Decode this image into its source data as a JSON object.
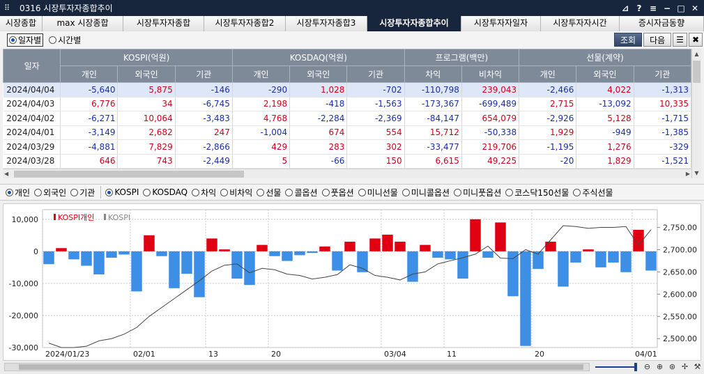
{
  "window": {
    "title": "0316 시장투자자종합추이",
    "icon": "grid-icon",
    "controls": [
      "pin-icon",
      "help-icon",
      "restore-icon",
      "minimize-icon",
      "maximize-icon",
      "close-icon"
    ],
    "control_glyphs": [
      "⊿",
      "?",
      "≡",
      "−",
      "□",
      "✕"
    ]
  },
  "tabs": [
    {
      "label": "시장종합",
      "w": 61
    },
    {
      "label": "max 시장종합",
      "w": 116
    },
    {
      "label": "시장투자자종합",
      "w": 116
    },
    {
      "label": "시장투자자종합2",
      "w": 117
    },
    {
      "label": "시장투자자종합3",
      "w": 117
    },
    {
      "label": "시장투자자종합추이",
      "w": 135,
      "active": true
    },
    {
      "label": "시장투자자일자",
      "w": 114
    },
    {
      "label": "시장투자자시간",
      "w": 113
    },
    {
      "label": "증시자금동향",
      "w": 121
    }
  ],
  "toolbar": {
    "radio_daily": "일자별",
    "radio_hourly": "시간별",
    "btn_query": "조회",
    "btn_next": "다음",
    "btn_list": "☰",
    "btn_tool": "✖"
  },
  "table": {
    "corner": "일자",
    "groups": [
      "KOSPI(억원)",
      "KOSDAQ(억원)",
      "프로그램(백만)",
      "선물(계약)"
    ],
    "subheaders": [
      "개인",
      "외국인",
      "기관",
      "개인",
      "외국인",
      "기관",
      "차익",
      "비차익",
      "개인",
      "외국인",
      "기관"
    ],
    "rows": [
      {
        "date": "2024/04/04",
        "vals": [
          "-5,640",
          "5,875",
          "-146",
          "-290",
          "1,028",
          "-702",
          "-110,798",
          "239,043",
          "-2,466",
          "4,022",
          "-1,313"
        ]
      },
      {
        "date": "2024/04/03",
        "vals": [
          "6,776",
          "34",
          "-6,745",
          "2,198",
          "-418",
          "-1,563",
          "-173,367",
          "-699,489",
          "2,715",
          "-13,092",
          "10,335"
        ]
      },
      {
        "date": "2024/04/02",
        "vals": [
          "-6,271",
          "10,064",
          "-3,483",
          "4,768",
          "-2,284",
          "-2,369",
          "-84,147",
          "654,079",
          "-2,926",
          "5,128",
          "-1,715"
        ]
      },
      {
        "date": "2024/04/01",
        "vals": [
          "-3,149",
          "2,682",
          "247",
          "-1,004",
          "674",
          "554",
          "15,712",
          "-50,338",
          "1,929",
          "-949",
          "-1,385"
        ]
      },
      {
        "date": "2024/03/29",
        "vals": [
          "-4,881",
          "7,829",
          "-2,866",
          "429",
          "283",
          "302",
          "-33,477",
          "219,706",
          "-1,195",
          "1,276",
          "-329"
        ]
      },
      {
        "date": "2024/03/28",
        "vals": [
          "646",
          "743",
          "-2,449",
          "5",
          "-66",
          "150",
          "6,615",
          "49,225",
          "-20",
          "1,829",
          "-1,521"
        ]
      }
    ]
  },
  "options": {
    "investor": [
      "개인",
      "외국인",
      "기관"
    ],
    "market": [
      "KOSPI",
      "KOSDAQ",
      "차익",
      "비차익",
      "선물",
      "콜옵션",
      "풋옵션",
      "미니선물",
      "미니콜옵션",
      "미니풋옵션",
      "코스닥150선물",
      "주식선물"
    ]
  },
  "chart_data": {
    "type": "bar",
    "legend": [
      "KOSPI개인",
      "KOSPI"
    ],
    "legend_placement": "top-left",
    "colors": {
      "positive": "#e00012",
      "negative": "#3d8fe6",
      "line": "#444444"
    },
    "y_left": {
      "ticks": [
        "10,000",
        "0",
        "-10,000",
        "-20,000",
        "-30,000"
      ],
      "tick_values": [
        10000,
        0,
        -10000,
        -20000,
        -30000
      ],
      "range": [
        -30000,
        13000
      ]
    },
    "y_right": {
      "ticks": [
        "2,750.00",
        "2,700.00",
        "2,650.00",
        "2,600.00",
        "2,550.00",
        "2,500.00"
      ],
      "tick_values": [
        2750,
        2700,
        2650,
        2600,
        2550,
        2500
      ],
      "range": [
        2480,
        2790
      ]
    },
    "x_labels": [
      {
        "label": "2024/01/23",
        "i": 0
      },
      {
        "label": "02/01",
        "i": 7
      },
      {
        "label": "13",
        "i": 13
      },
      {
        "label": "20",
        "i": 18
      },
      {
        "label": "03/04",
        "i": 27
      },
      {
        "label": "11",
        "i": 32
      },
      {
        "label": "20",
        "i": 39
      },
      {
        "label": "04/01",
        "i": 47
      }
    ],
    "bars": [
      -4000,
      1000,
      -2500,
      -4500,
      -7200,
      -2000,
      -1000,
      -12500,
      5000,
      -1500,
      -11500,
      -7000,
      -14300,
      4000,
      600,
      -8500,
      -10500,
      2000,
      -1500,
      -3000,
      -1200,
      -500,
      1500,
      -6000,
      3000,
      -6500,
      4000,
      5200,
      3000,
      -9500,
      2000,
      -2000,
      -2500,
      -8500,
      10000,
      -2000,
      9000,
      -14000,
      -29500,
      -5500,
      3000,
      -11000,
      -3500,
      600,
      -5000,
      -3500,
      -6500,
      6700,
      -6000
    ],
    "line": [
      2490,
      2480,
      2480,
      2483,
      2495,
      2500,
      2510,
      2525,
      2550,
      2570,
      2590,
      2610,
      2630,
      2652,
      2665,
      2668,
      2648,
      2658,
      2655,
      2645,
      2642,
      2634,
      2638,
      2644,
      2666,
      2658,
      2642,
      2638,
      2632,
      2645,
      2650,
      2668,
      2675,
      2682,
      2690,
      2708,
      2681,
      2680,
      2700,
      2690,
      2722,
      2754,
      2752,
      2748,
      2750,
      2750,
      2752,
      2710,
      2745
    ]
  }
}
